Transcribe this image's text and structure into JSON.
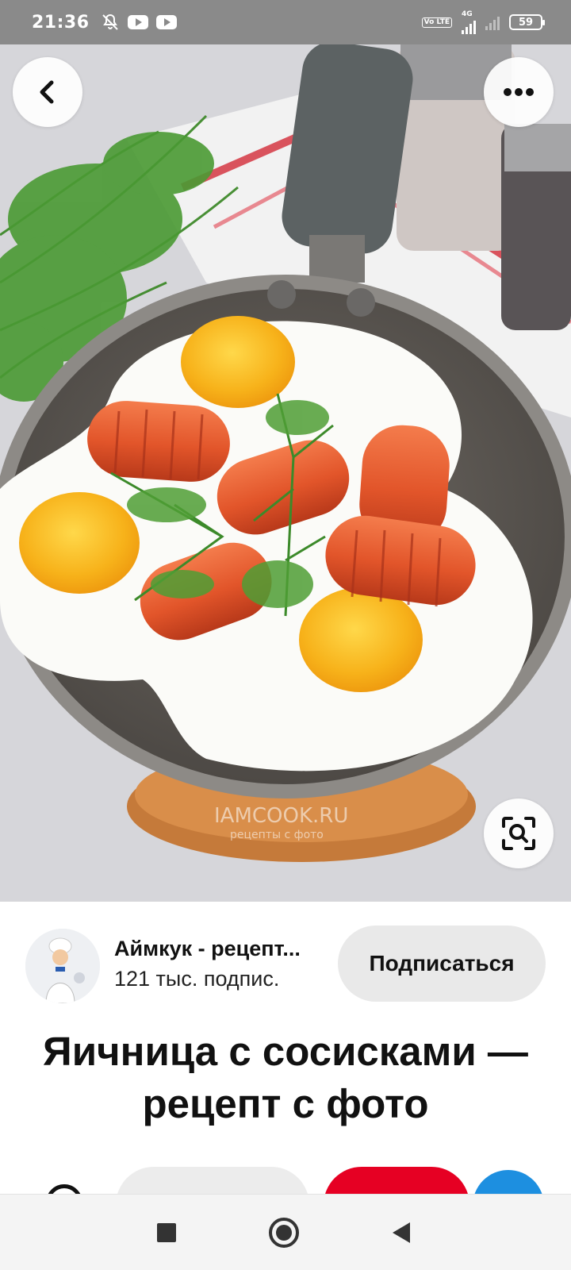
{
  "status_bar": {
    "time": "21:36",
    "network_label": "4G",
    "volte_label": "Vo LTE",
    "battery": "59",
    "icons": [
      "dnd-off-icon",
      "youtube-icon",
      "youtube-icon",
      "signal-icon",
      "battery-icon"
    ]
  },
  "pin": {
    "image_watermark": "IAMCOOK.RU",
    "image_watermark_sub": "рецепты с фото",
    "title": "Яичница с сосисками — рецепт с фото"
  },
  "author": {
    "name": "Аймкук - рецепт...",
    "subscribers": "121 тыс. подпис.",
    "follow_label": "Подписаться"
  },
  "colors": {
    "status_bar": "#8a8a8a",
    "follow_button": "#e9e9e9",
    "save_button": "#e60023",
    "share_button": "#1d8fe0"
  }
}
